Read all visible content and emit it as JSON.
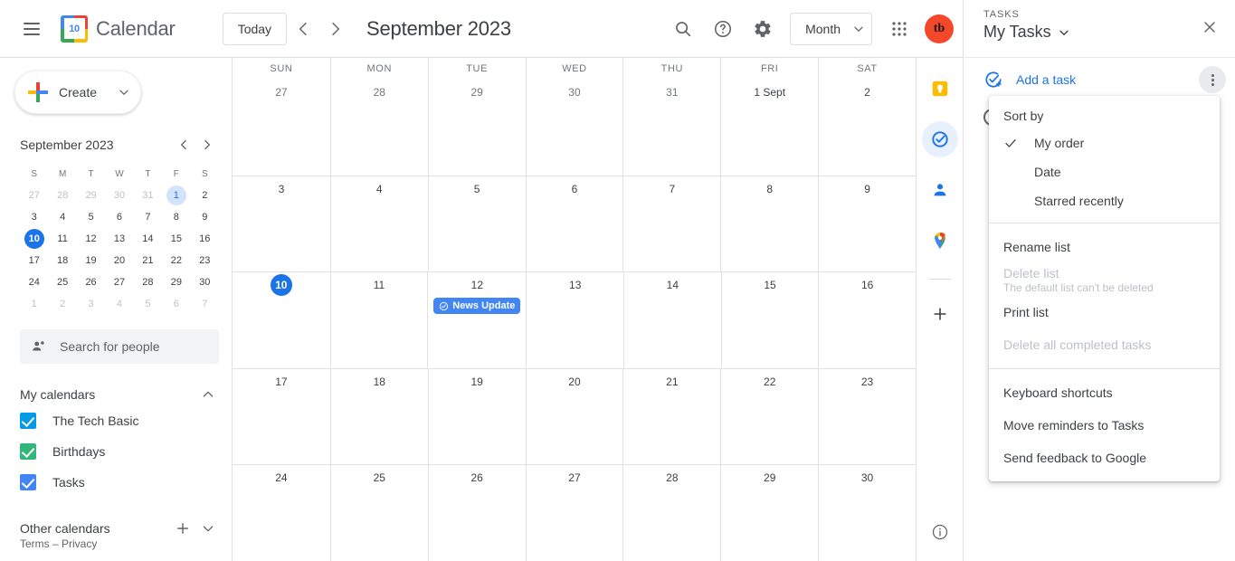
{
  "header": {
    "menu_icon": "hamburger-icon",
    "logo_day": "10",
    "app_title": "Calendar",
    "today_label": "Today",
    "prev_icon": "chevron-left-icon",
    "next_icon": "chevron-right-icon",
    "period_title": "September 2023",
    "search_icon": "search-icon",
    "help_icon": "help-icon",
    "settings_icon": "gear-icon",
    "view_label": "Month",
    "view_caret": "chevron-down-icon",
    "apps_icon": "google-apps-grid-icon",
    "avatar_initials": "tb",
    "avatar_color": "#f4482b"
  },
  "sidebar": {
    "create_label": "Create",
    "create_caret": "chevron-down-icon",
    "mini_calendar": {
      "title": "September 2023",
      "prev_icon": "chevron-left-icon",
      "next_icon": "chevron-right-icon",
      "dow": [
        "S",
        "M",
        "T",
        "W",
        "T",
        "F",
        "S"
      ],
      "weeks": [
        [
          {
            "d": "27",
            "state": "muted"
          },
          {
            "d": "28",
            "state": "muted"
          },
          {
            "d": "29",
            "state": "muted"
          },
          {
            "d": "30",
            "state": "muted"
          },
          {
            "d": "31",
            "state": "muted"
          },
          {
            "d": "1",
            "state": "soft"
          },
          {
            "d": "2",
            "state": "normal"
          }
        ],
        [
          {
            "d": "3",
            "state": "normal"
          },
          {
            "d": "4",
            "state": "normal"
          },
          {
            "d": "5",
            "state": "normal"
          },
          {
            "d": "6",
            "state": "normal"
          },
          {
            "d": "7",
            "state": "normal"
          },
          {
            "d": "8",
            "state": "normal"
          },
          {
            "d": "9",
            "state": "normal"
          }
        ],
        [
          {
            "d": "10",
            "state": "today"
          },
          {
            "d": "11",
            "state": "normal"
          },
          {
            "d": "12",
            "state": "normal"
          },
          {
            "d": "13",
            "state": "normal"
          },
          {
            "d": "14",
            "state": "normal"
          },
          {
            "d": "15",
            "state": "normal"
          },
          {
            "d": "16",
            "state": "normal"
          }
        ],
        [
          {
            "d": "17",
            "state": "normal"
          },
          {
            "d": "18",
            "state": "normal"
          },
          {
            "d": "19",
            "state": "normal"
          },
          {
            "d": "20",
            "state": "normal"
          },
          {
            "d": "21",
            "state": "normal"
          },
          {
            "d": "22",
            "state": "normal"
          },
          {
            "d": "23",
            "state": "normal"
          }
        ],
        [
          {
            "d": "24",
            "state": "normal"
          },
          {
            "d": "25",
            "state": "normal"
          },
          {
            "d": "26",
            "state": "normal"
          },
          {
            "d": "27",
            "state": "normal"
          },
          {
            "d": "28",
            "state": "normal"
          },
          {
            "d": "29",
            "state": "normal"
          },
          {
            "d": "30",
            "state": "normal"
          }
        ],
        [
          {
            "d": "1",
            "state": "muted"
          },
          {
            "d": "2",
            "state": "muted"
          },
          {
            "d": "3",
            "state": "muted"
          },
          {
            "d": "4",
            "state": "muted"
          },
          {
            "d": "5",
            "state": "muted"
          },
          {
            "d": "6",
            "state": "muted"
          },
          {
            "d": "7",
            "state": "muted"
          }
        ]
      ]
    },
    "search_people": {
      "icon": "people-search-icon",
      "placeholder": "Search for people"
    },
    "my_calendars": {
      "title": "My calendars",
      "collapse_icon": "chevron-up-icon",
      "items": [
        {
          "label": "The Tech Basic",
          "color": "#039be5",
          "checked": true
        },
        {
          "label": "Birthdays",
          "color": "#33b679",
          "checked": true
        },
        {
          "label": "Tasks",
          "color": "#4285f4",
          "checked": true
        }
      ]
    },
    "other_calendars": {
      "title": "Other calendars",
      "add_icon": "plus-icon",
      "expand_icon": "chevron-down-icon"
    },
    "terms": "Terms – Privacy"
  },
  "calendar": {
    "day_headers": [
      "SUN",
      "MON",
      "TUE",
      "WED",
      "THU",
      "FRI",
      "SAT"
    ],
    "weeks": [
      [
        {
          "num": "27",
          "state": "muted",
          "events": []
        },
        {
          "num": "28",
          "state": "muted",
          "events": []
        },
        {
          "num": "29",
          "state": "muted",
          "events": []
        },
        {
          "num": "30",
          "state": "muted",
          "events": []
        },
        {
          "num": "31",
          "state": "muted",
          "events": []
        },
        {
          "num": "1 Sept",
          "state": "normal",
          "events": []
        },
        {
          "num": "2",
          "state": "normal",
          "events": []
        }
      ],
      [
        {
          "num": "3",
          "state": "normal",
          "events": []
        },
        {
          "num": "4",
          "state": "normal",
          "events": []
        },
        {
          "num": "5",
          "state": "normal",
          "events": []
        },
        {
          "num": "6",
          "state": "normal",
          "events": []
        },
        {
          "num": "7",
          "state": "normal",
          "events": []
        },
        {
          "num": "8",
          "state": "normal",
          "events": []
        },
        {
          "num": "9",
          "state": "normal",
          "events": []
        }
      ],
      [
        {
          "num": "10",
          "state": "today",
          "events": []
        },
        {
          "num": "11",
          "state": "normal",
          "events": []
        },
        {
          "num": "12",
          "state": "normal",
          "events": [
            {
              "title": "News Update",
              "icon": "task-check-icon",
              "color": "#4285f4"
            }
          ]
        },
        {
          "num": "13",
          "state": "normal",
          "events": []
        },
        {
          "num": "14",
          "state": "normal",
          "events": []
        },
        {
          "num": "15",
          "state": "normal",
          "events": []
        },
        {
          "num": "16",
          "state": "normal",
          "events": []
        }
      ],
      [
        {
          "num": "17",
          "state": "normal",
          "events": []
        },
        {
          "num": "18",
          "state": "normal",
          "events": []
        },
        {
          "num": "19",
          "state": "normal",
          "events": []
        },
        {
          "num": "20",
          "state": "normal",
          "events": []
        },
        {
          "num": "21",
          "state": "normal",
          "events": []
        },
        {
          "num": "22",
          "state": "normal",
          "events": []
        },
        {
          "num": "23",
          "state": "normal",
          "events": []
        }
      ],
      [
        {
          "num": "24",
          "state": "normal",
          "events": []
        },
        {
          "num": "25",
          "state": "normal",
          "events": []
        },
        {
          "num": "26",
          "state": "normal",
          "events": []
        },
        {
          "num": "27",
          "state": "normal",
          "events": []
        },
        {
          "num": "28",
          "state": "normal",
          "events": []
        },
        {
          "num": "29",
          "state": "normal",
          "events": []
        },
        {
          "num": "30",
          "state": "normal",
          "events": []
        }
      ]
    ]
  },
  "side_rail": {
    "items": [
      {
        "name": "google-keep-icon",
        "active": false
      },
      {
        "name": "google-tasks-icon",
        "active": true
      },
      {
        "name": "google-contacts-icon",
        "active": false
      },
      {
        "name": "google-maps-icon",
        "active": false
      }
    ],
    "add_icon": "plus-icon",
    "info_icon": "info-icon"
  },
  "tasks_panel": {
    "kicker": "TASKS",
    "list_name": "My Tasks",
    "list_caret": "chevron-down-icon",
    "close_icon": "close-icon",
    "add_task_icon": "add-task-icon",
    "add_task_label": "Add a task",
    "more_icon": "more-vertical-icon"
  },
  "menu": {
    "sort_by_label": "Sort by",
    "sort_options": [
      {
        "label": "My order",
        "selected": true
      },
      {
        "label": "Date",
        "selected": false
      },
      {
        "label": "Starred recently",
        "selected": false
      }
    ],
    "items": [
      {
        "label": "Rename list",
        "sub": "",
        "disabled": false
      },
      {
        "label": "Delete list",
        "sub": "The default list can't be deleted",
        "disabled": true
      },
      {
        "label": "Print list",
        "sub": "",
        "disabled": false
      },
      {
        "label": "Delete all completed tasks",
        "sub": "",
        "disabled": true
      }
    ],
    "items2": [
      {
        "label": "Keyboard shortcuts",
        "sub": "",
        "disabled": false
      },
      {
        "label": "Move reminders to Tasks",
        "sub": "",
        "disabled": false
      },
      {
        "label": "Send feedback to Google",
        "sub": "",
        "disabled": false
      }
    ],
    "check_icon": "check-icon"
  }
}
